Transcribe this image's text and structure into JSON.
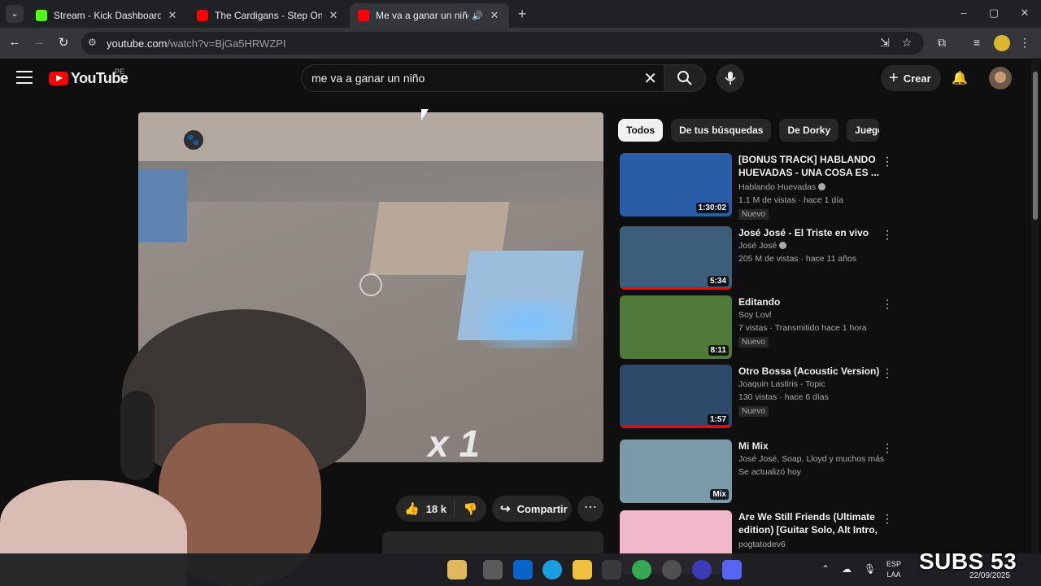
{
  "browser": {
    "tabs": [
      {
        "title": "Stream - Kick Dashboard",
        "favicon_color": "#53fc18"
      },
      {
        "title": "The Cardigans - Step On Me (A",
        "favicon_color": "#ff0000"
      },
      {
        "title": "Me va a ganar un niño!! (Fr",
        "favicon_color": "#ff0000",
        "active": true
      }
    ],
    "url_host": "youtube.com",
    "url_path": "/watch?v=BjGa5HRWZPI"
  },
  "youtube": {
    "logo_text": "YouTube",
    "country": "PE",
    "search_query": "me va a ganar un niño",
    "create_label": "Crear"
  },
  "video": {
    "hud_text": "x 1"
  },
  "actions": {
    "likes": "18 k",
    "share_label": "Compartir"
  },
  "chips": [
    "Todos",
    "De tus búsquedas",
    "De Dorky",
    "Juego"
  ],
  "recommendations": [
    {
      "title": "[BONUS TRACK] HABLANDO HUEVADAS - UNA COSA ES ...",
      "channel": "Hablando Huevadas",
      "verified": true,
      "meta": "1.1 M de vistas · hace 1 día",
      "badge": "Nuevo",
      "duration": "1:30:02",
      "thumb_color": "#2a5da8"
    },
    {
      "title": "José José - El Triste en vivo",
      "channel": "José José",
      "verified": true,
      "meta": "205 M de vistas · hace 11 años",
      "badge": "",
      "duration": "5:34",
      "thumb_color": "#3d5e7a",
      "progress": 1.0
    },
    {
      "title": "Editando",
      "channel": "Soy Lovl",
      "verified": false,
      "meta": "7 vistas · Transmitido hace 1 hora",
      "badge": "Nuevo",
      "duration": "8:11",
      "thumb_color": "#4f7a3a"
    },
    {
      "title": "Otro Bossa (Acoustic Version)",
      "channel": "Joaquin Lastiris - Topic",
      "verified": false,
      "meta": "130 vistas · hace 6 días",
      "badge": "Nuevo",
      "duration": "1:57",
      "thumb_color": "#2d4a6a",
      "progress": 1.0
    },
    {
      "title": "Mi Mix",
      "channel": "José José, Soap, Lloyd y muchos más",
      "verified": false,
      "meta": "Se actualizó hoy",
      "badge": "",
      "duration": "Mix",
      "thumb_color": "#7a9aaa"
    },
    {
      "title": "Are We Still Friends (Ultimate edition) [Guitar Solo, Alt Intro, ...",
      "channel": "pogtatodev6",
      "verified": false,
      "meta": "",
      "badge": "",
      "duration": "",
      "thumb_color": "#f0b8c8"
    }
  ],
  "system": {
    "lang_line1": "ESP",
    "lang_line2": "LAA",
    "overlay_text": "SUBS 53",
    "date": "22/09/2025"
  }
}
